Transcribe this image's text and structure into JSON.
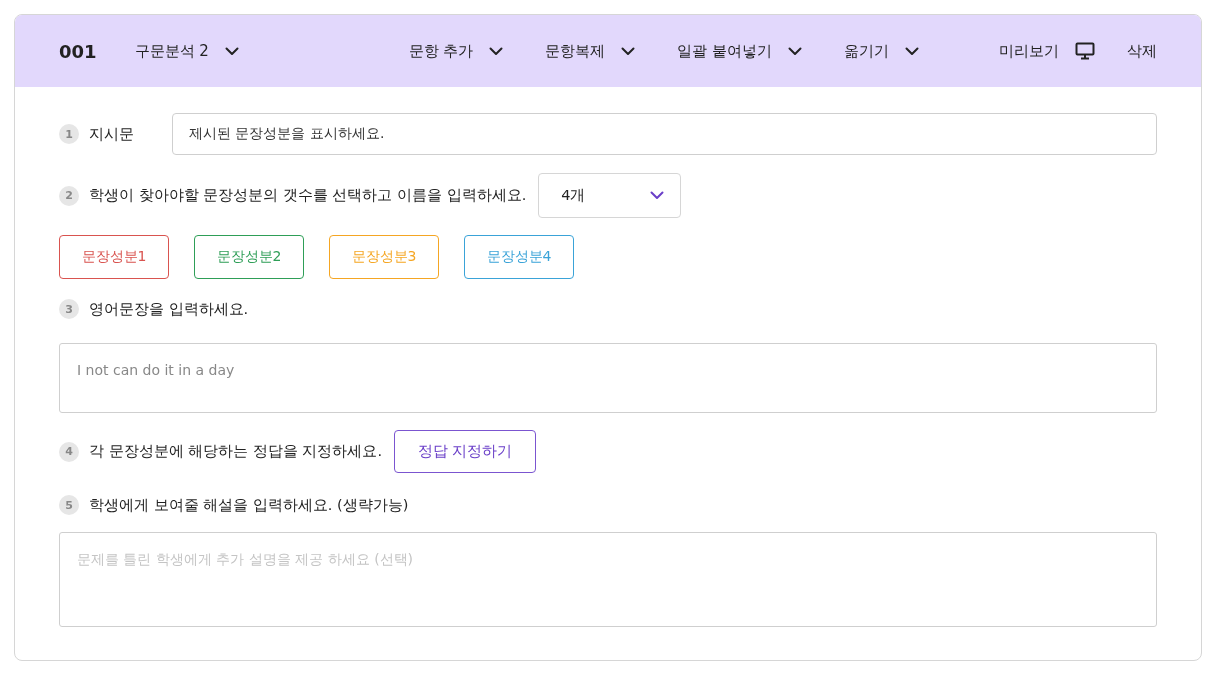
{
  "header": {
    "number": "001",
    "type_menu": "구문분석 2",
    "menus": [
      "문항 추가",
      "문항복제",
      "일괄 붙여넣기",
      "옮기기"
    ],
    "preview": "미리보기",
    "delete": "삭제"
  },
  "steps": [
    {
      "kind": "field",
      "number": "1",
      "label": "지시문",
      "value": "제시된 문장성분을 표시하세요."
    },
    {
      "kind": "select",
      "number": "2",
      "label": "학생이 찾아야할 문장성분의 갯수를 선택하고 이름을 입력하세요.",
      "value": "4개",
      "components": [
        {
          "label": "문장성분1",
          "color": "#d9534f"
        },
        {
          "label": "문장성분2",
          "color": "#2e9e57"
        },
        {
          "label": "문장성분3",
          "color": "#f5a623"
        },
        {
          "label": "문장성분4",
          "color": "#3aa3d8"
        }
      ]
    },
    {
      "kind": "textarea",
      "number": "3",
      "label": "영어문장을 입력하세요.",
      "value": "I not can do it in a day"
    },
    {
      "kind": "button",
      "number": "4",
      "label": "각 문장성분에 해당하는 정답을 지정하세요.",
      "button": "정답 지정하기"
    },
    {
      "kind": "textarea",
      "number": "5",
      "label": "학생에게 보여줄 해설을 입력하세요. (생략가능)",
      "placeholder": "문제를 틀린 학생에게 추가 설명을 제공 하세요 (선택)"
    }
  ]
}
